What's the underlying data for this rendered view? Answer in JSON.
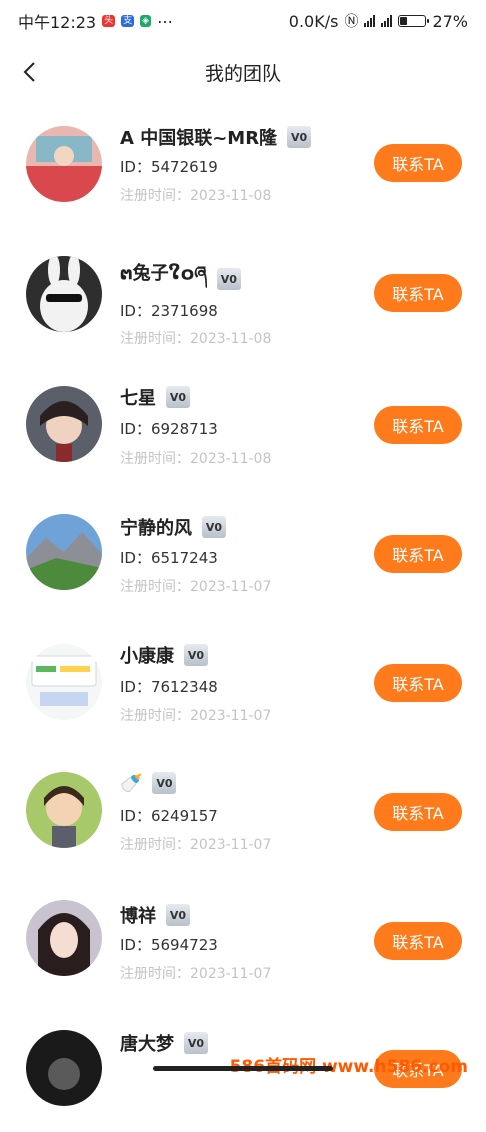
{
  "status_bar": {
    "time": "中午12:23",
    "network_speed": "0.0K/s",
    "battery": "27%"
  },
  "header": {
    "title": "我的团队"
  },
  "members": [
    {
      "name": "A 中国银联~MR隆",
      "level": "V0",
      "id_text": "ID：5472619",
      "reg_text": "注册时间：2023-11-08",
      "action": "联系TA"
    },
    {
      "name": "ຕ兔子ໃ໐ཞ",
      "level": "V0",
      "id_text": "ID：2371698",
      "reg_text": "注册时间：2023-11-08",
      "action": "联系TA"
    },
    {
      "name": "七星",
      "level": "V0",
      "id_text": "ID：6928713",
      "reg_text": "注册时间：2023-11-08",
      "action": "联系TA"
    },
    {
      "name": "宁静的风",
      "level": "V0",
      "id_text": "ID：6517243",
      "reg_text": "注册时间：2023-11-07",
      "action": "联系TA"
    },
    {
      "name": "小康康",
      "level": "V0",
      "id_text": "ID：7612348",
      "reg_text": "注册时间：2023-11-07",
      "action": "联系TA"
    },
    {
      "name": "🍼",
      "level": "V0",
      "id_text": "ID：6249157",
      "reg_text": "注册时间：2023-11-07",
      "action": "联系TA"
    },
    {
      "name": "博祥",
      "level": "V0",
      "id_text": "ID：5694723",
      "reg_text": "注册时间：2023-11-07",
      "action": "联系TA"
    },
    {
      "name": "唐大梦",
      "level": "V0",
      "id_text": "",
      "reg_text": "",
      "action": "联系TA"
    }
  ],
  "watermark": "586首码网 www.h586.com",
  "icons": {
    "back": "chevron-left-icon"
  }
}
